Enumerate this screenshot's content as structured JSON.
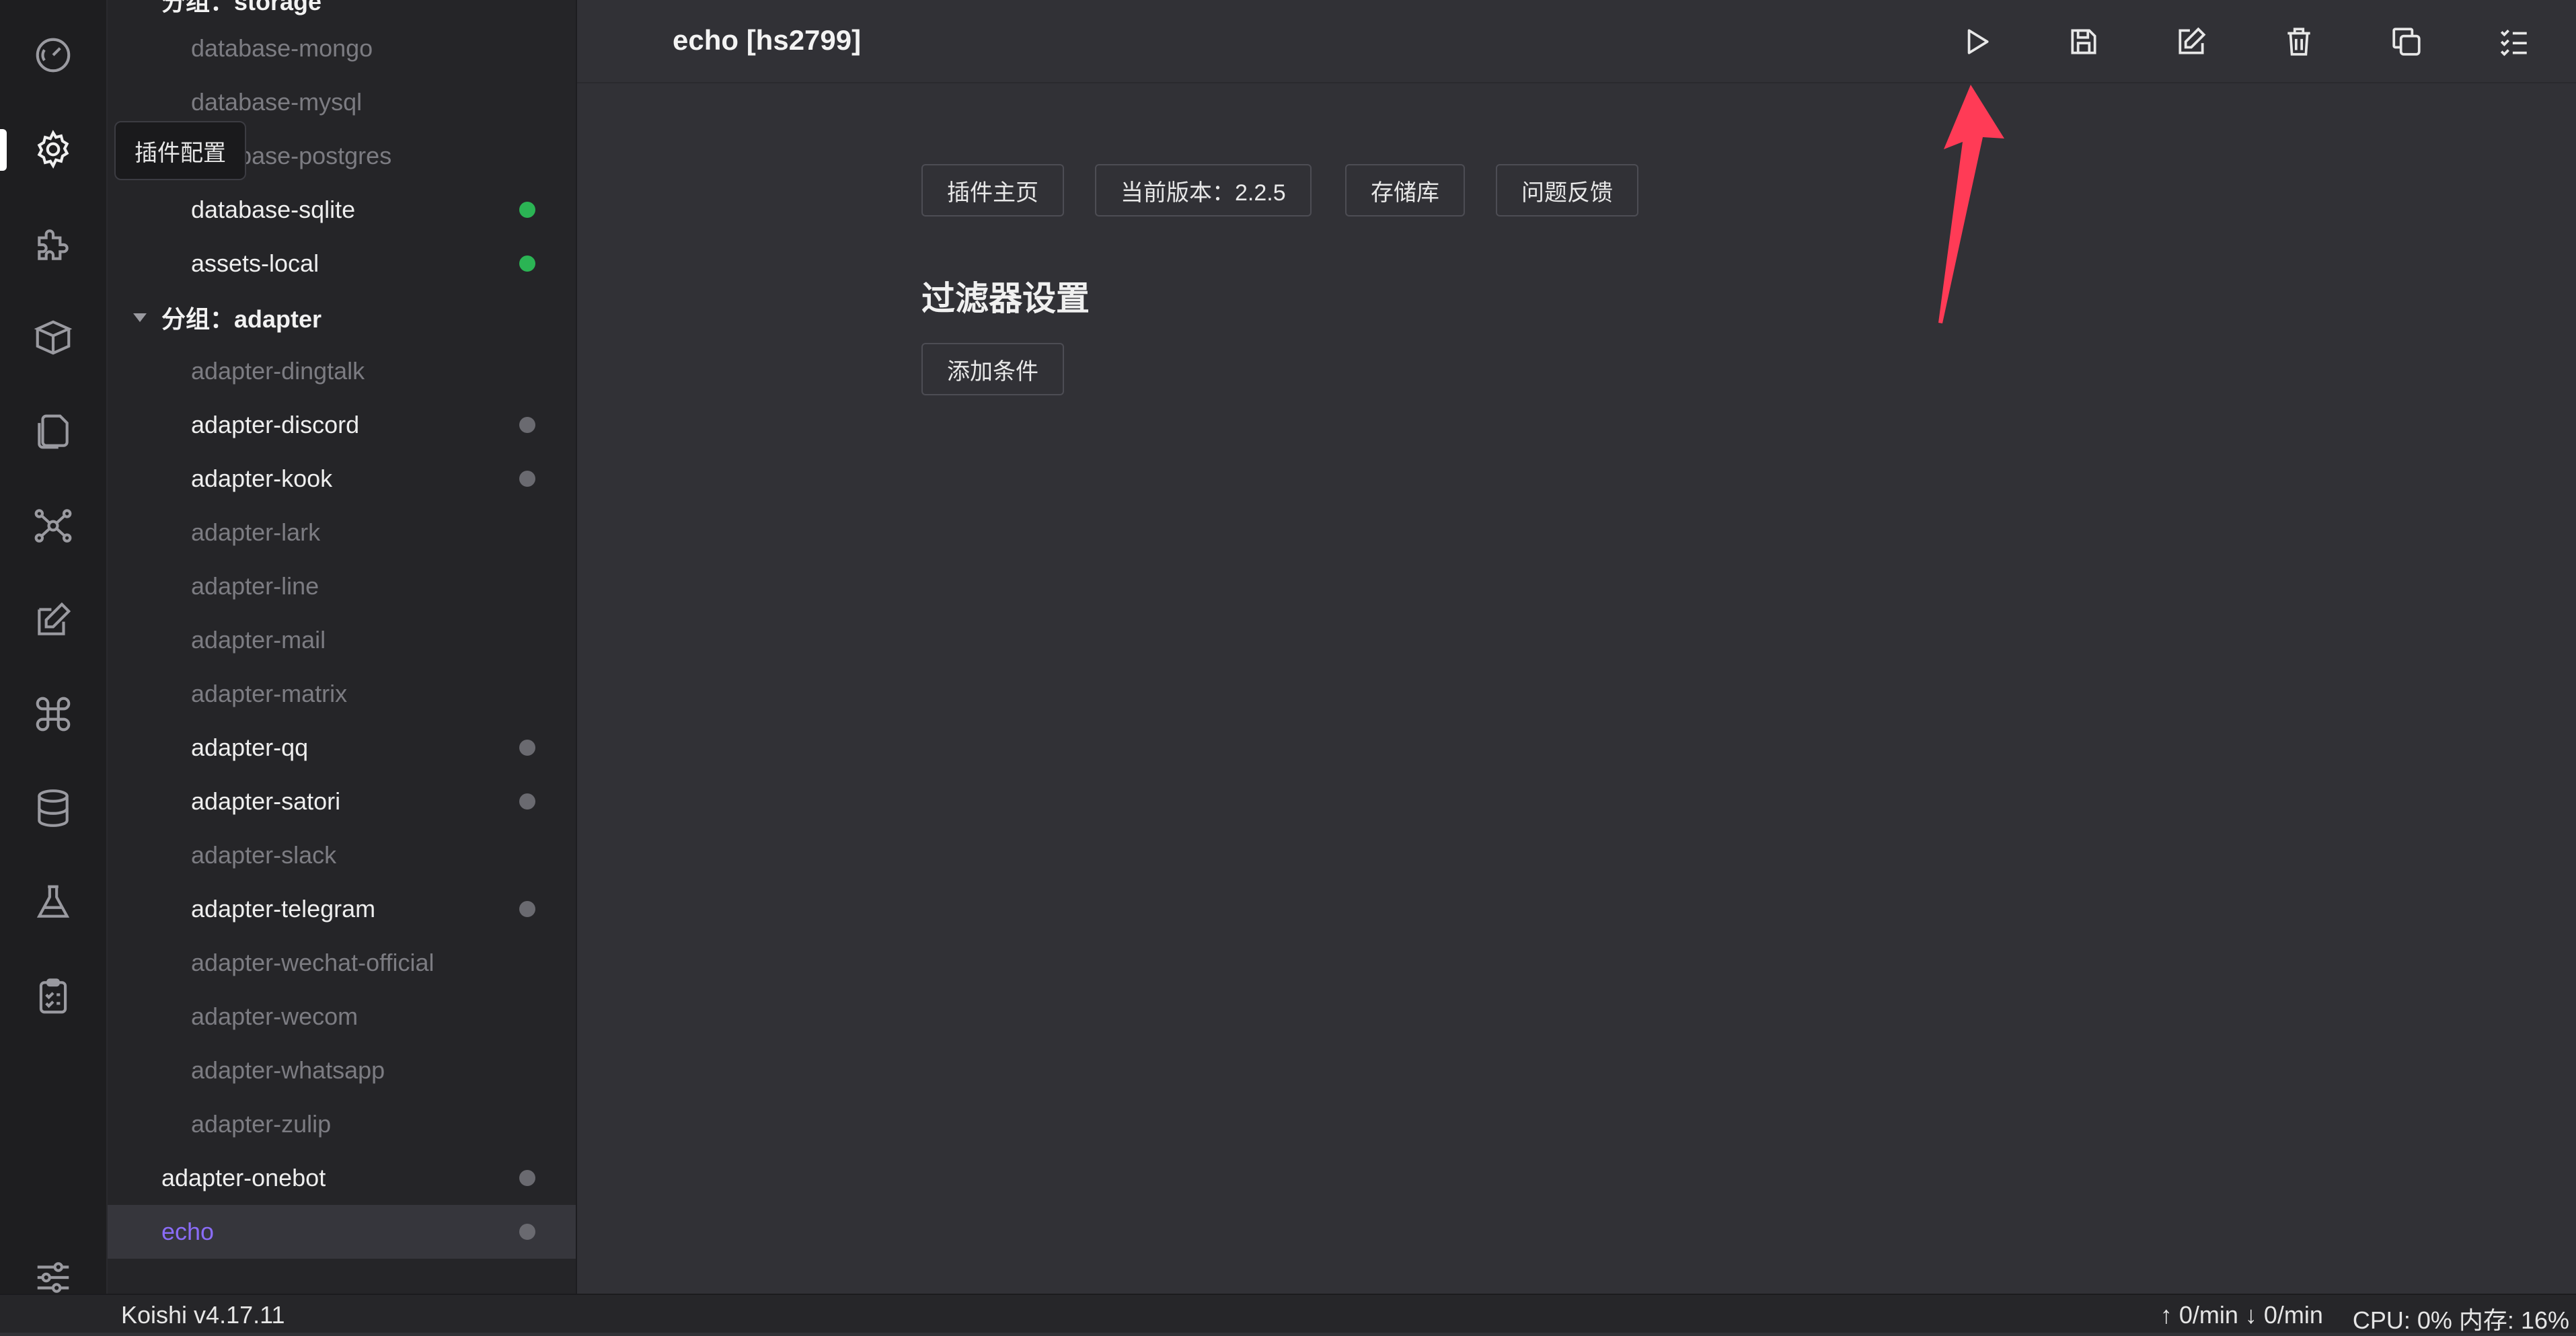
{
  "activity_bar": {
    "tooltip": "插件配置",
    "icons": [
      "dashboard-icon",
      "gear-icon",
      "puzzle-icon",
      "package-icon",
      "files-icon",
      "network-icon",
      "edit-icon",
      "command-icon",
      "database-icon",
      "flask-icon",
      "clipboard-icon",
      "sliders-icon"
    ]
  },
  "sidebar": {
    "items": [
      {
        "label": "分组：storage",
        "kind": "group",
        "status": "none"
      },
      {
        "label": "database-mongo",
        "kind": "child",
        "status": "disabled"
      },
      {
        "label": "database-mysql",
        "kind": "child",
        "status": "disabled"
      },
      {
        "label": "database-postgres",
        "kind": "child",
        "status": "disabled"
      },
      {
        "label": "database-sqlite",
        "kind": "child",
        "status": "green"
      },
      {
        "label": "assets-local",
        "kind": "child",
        "status": "green"
      },
      {
        "label": "分组：adapter",
        "kind": "group",
        "status": "none"
      },
      {
        "label": "adapter-dingtalk",
        "kind": "child",
        "status": "disabled"
      },
      {
        "label": "adapter-discord",
        "kind": "child",
        "status": "gray"
      },
      {
        "label": "adapter-kook",
        "kind": "child",
        "status": "gray"
      },
      {
        "label": "adapter-lark",
        "kind": "child",
        "status": "disabled"
      },
      {
        "label": "adapter-line",
        "kind": "child",
        "status": "disabled"
      },
      {
        "label": "adapter-mail",
        "kind": "child",
        "status": "disabled"
      },
      {
        "label": "adapter-matrix",
        "kind": "child",
        "status": "disabled"
      },
      {
        "label": "adapter-qq",
        "kind": "child",
        "status": "gray"
      },
      {
        "label": "adapter-satori",
        "kind": "child",
        "status": "gray"
      },
      {
        "label": "adapter-slack",
        "kind": "child",
        "status": "disabled"
      },
      {
        "label": "adapter-telegram",
        "kind": "child",
        "status": "gray"
      },
      {
        "label": "adapter-wechat-official",
        "kind": "child",
        "status": "disabled"
      },
      {
        "label": "adapter-wecom",
        "kind": "child",
        "status": "disabled"
      },
      {
        "label": "adapter-whatsapp",
        "kind": "child",
        "status": "disabled"
      },
      {
        "label": "adapter-zulip",
        "kind": "child",
        "status": "disabled"
      },
      {
        "label": "adapter-onebot",
        "kind": "top",
        "status": "gray"
      },
      {
        "label": "echo",
        "kind": "top",
        "status": "gray",
        "selected": true
      }
    ]
  },
  "header": {
    "title": "echo [hs2799]",
    "tools": [
      "play-icon",
      "save-icon",
      "edit-icon",
      "trash-icon",
      "copy-icon",
      "checklist-icon"
    ]
  },
  "main": {
    "buttons": [
      "插件主页",
      "当前版本：2.2.5",
      "存储库",
      "问题反馈"
    ],
    "filter_title": "过滤器设置",
    "add_condition": "添加条件"
  },
  "statusbar": {
    "version": "Koishi v4.17.11",
    "traffic": "↑ 0/min ↓ 0/min",
    "resources": "CPU: 0% 内存: 16%"
  },
  "colors": {
    "accent": "#8a6cf7",
    "status_green": "#2bb454",
    "status_gray": "#6a6a70",
    "annotation_arrow": "#ff3b56"
  }
}
